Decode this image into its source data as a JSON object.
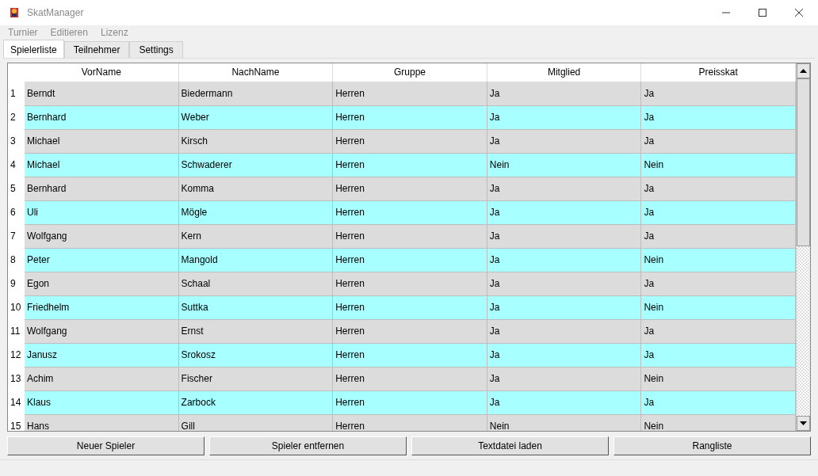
{
  "window": {
    "title": "SkatManager"
  },
  "menu": [
    {
      "label": "Turnier",
      "disabled": true
    },
    {
      "label": "Editieren",
      "disabled": true
    },
    {
      "label": "Lizenz",
      "disabled": true
    }
  ],
  "tabs": [
    {
      "label": "Spielerliste",
      "selected": true
    },
    {
      "label": "Teilnehmer",
      "selected": false
    },
    {
      "label": "Settings",
      "selected": false
    }
  ],
  "table": {
    "columns": [
      "VorName",
      "NachName",
      "Gruppe",
      "Mitglied",
      "Preisskat"
    ],
    "rows": [
      {
        "index": "1",
        "cells": [
          "Berndt",
          "Biedermann",
          "Herren",
          "Ja",
          "Ja"
        ]
      },
      {
        "index": "2",
        "cells": [
          "Bernhard",
          "Weber",
          "Herren",
          "Ja",
          "Ja"
        ]
      },
      {
        "index": "3",
        "cells": [
          "Michael",
          "Kirsch",
          "Herren",
          "Ja",
          "Ja"
        ]
      },
      {
        "index": "4",
        "cells": [
          "Michael",
          "Schwaderer",
          "Herren",
          "Nein",
          "Nein"
        ]
      },
      {
        "index": "5",
        "cells": [
          "Bernhard",
          "Komma",
          "Herren",
          "Ja",
          "Ja"
        ]
      },
      {
        "index": "6",
        "cells": [
          "Uli",
          "Mögle",
          "Herren",
          "Ja",
          "Ja"
        ]
      },
      {
        "index": "7",
        "cells": [
          "Wolfgang",
          "Kern",
          "Herren",
          "Ja",
          "Ja"
        ]
      },
      {
        "index": "8",
        "cells": [
          "Peter",
          "Mangold",
          "Herren",
          "Ja",
          "Nein"
        ]
      },
      {
        "index": "9",
        "cells": [
          "Egon",
          "Schaal",
          "Herren",
          "Ja",
          "Ja"
        ]
      },
      {
        "index": "10",
        "cells": [
          "Friedhelm",
          "Suttka",
          "Herren",
          "Ja",
          "Nein"
        ]
      },
      {
        "index": "11",
        "cells": [
          "Wolfgang",
          "Ernst",
          "Herren",
          "Ja",
          "Ja"
        ]
      },
      {
        "index": "12",
        "cells": [
          "Janusz",
          "Srokosz",
          "Herren",
          "Ja",
          "Ja"
        ]
      },
      {
        "index": "13",
        "cells": [
          "Achim",
          "Fischer",
          "Herren",
          "Ja",
          "Nein"
        ]
      },
      {
        "index": "14",
        "cells": [
          "Klaus",
          "Zarbock",
          "Herren",
          "Ja",
          "Ja"
        ]
      },
      {
        "index": "15",
        "cells": [
          "Hans",
          "Gill",
          "Herren",
          "Nein",
          "Nein"
        ]
      }
    ]
  },
  "buttons": [
    "Neuer Spieler",
    "Spieler entfernen",
    "Textdatei laden",
    "Rangliste"
  ]
}
